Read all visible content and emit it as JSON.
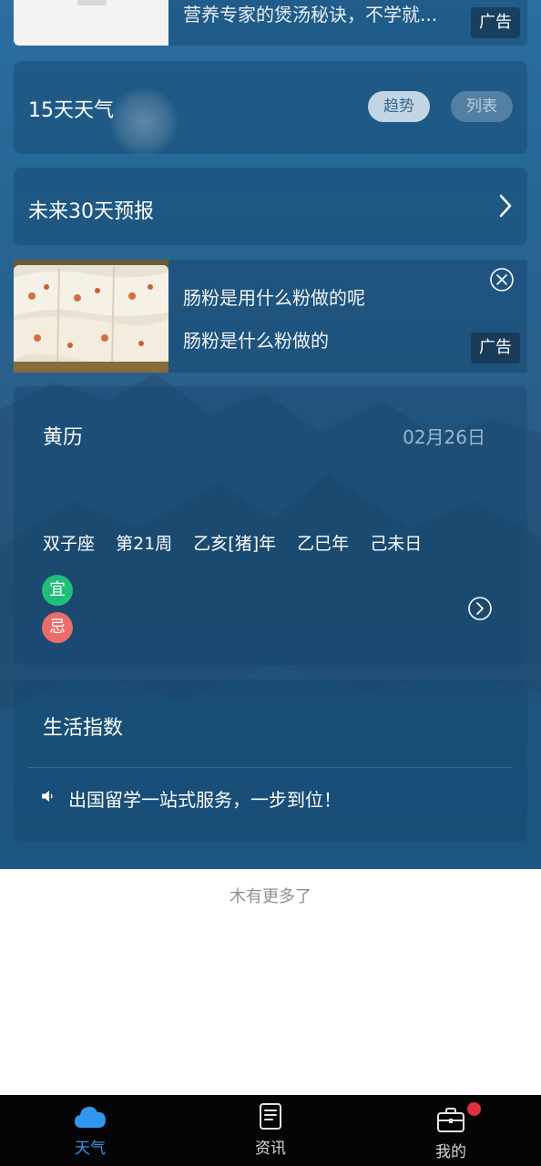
{
  "ad_top": {
    "text": "营养专家的煲汤秘诀，不学就...",
    "tag": "广告"
  },
  "weather15": {
    "title": "15天天气",
    "trend_label": "趋势",
    "list_label": "列表"
  },
  "forecast30": {
    "title": "未来30天预报"
  },
  "ad2": {
    "line1": "肠粉是用什么粉做的呢",
    "line2": "肠粉是什么粉做的",
    "tag": "广告"
  },
  "almanac": {
    "title": "黄历",
    "date": "02月26日",
    "info": [
      "双子座",
      "第21周",
      "乙亥[猪]年",
      "乙巳年",
      "己未日"
    ],
    "yi": "宜",
    "ji": "忌"
  },
  "life_index": {
    "title": "生活指数",
    "notice": "出国留学一站式服务，一步到位！"
  },
  "footer": {
    "no_more": "木有更多了"
  },
  "tabbar": {
    "weather": "天气",
    "news": "资讯",
    "mine": "我的"
  },
  "colors": {
    "accent": "#2f97f0",
    "yi": "#1fbf7a",
    "ji": "#ec6b6b",
    "notification": "#e0303f"
  }
}
